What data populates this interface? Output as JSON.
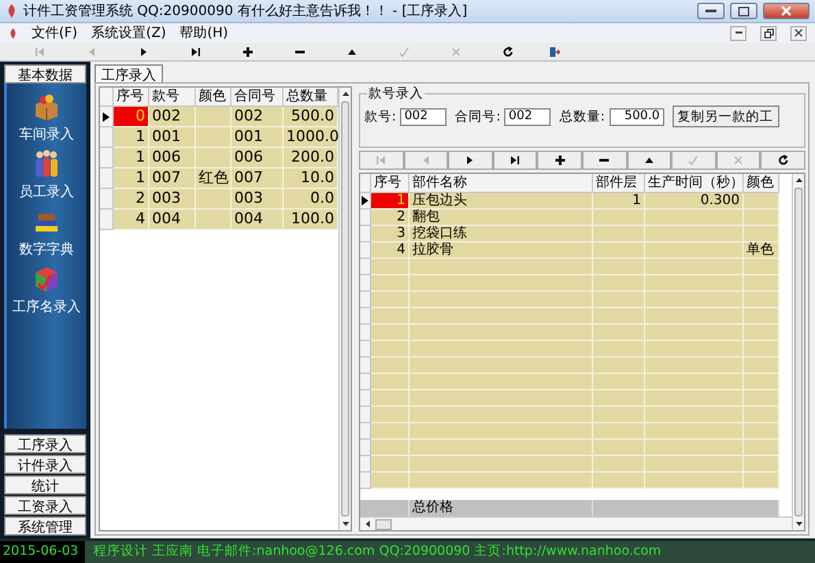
{
  "window": {
    "title": "计件工资管理系统  QQ:20900090    有什么好主意告诉我！！ - [工序录入]"
  },
  "menu": [
    "文件(F)",
    "系统设置(Z)",
    "帮助(H)"
  ],
  "toolbar": [
    {
      "kind": "first",
      "disabled": true
    },
    {
      "kind": "prior",
      "disabled": true
    },
    {
      "kind": "next",
      "disabled": false
    },
    {
      "kind": "last",
      "disabled": false
    },
    {
      "kind": "insert",
      "disabled": false
    },
    {
      "kind": "delete",
      "disabled": false
    },
    {
      "kind": "edit",
      "disabled": false
    },
    {
      "kind": "post",
      "disabled": true
    },
    {
      "kind": "cancel",
      "disabled": true
    },
    {
      "kind": "refresh",
      "disabled": false
    },
    {
      "kind": "exit",
      "disabled": false
    }
  ],
  "sidebar": {
    "header": "基本数据",
    "items": [
      {
        "kind": "box",
        "label": "车间录入"
      },
      {
        "kind": "people",
        "label": "员工录入"
      },
      {
        "kind": "books",
        "label": "数字字典"
      },
      {
        "kind": "cube",
        "label": "工序名录入"
      }
    ],
    "buttons": [
      "工序录入",
      "计件录入",
      "统计",
      "工资录入",
      "系统管理"
    ]
  },
  "tab": {
    "label": "工序录入",
    "selected": true
  },
  "style_grid": {
    "columns": [
      "序号",
      "款号",
      "颜色",
      "合同号",
      "总数量"
    ],
    "rows": [
      {
        "selected": true,
        "cells": [
          "0",
          "002",
          "",
          "002",
          "500.0"
        ]
      },
      {
        "selected": false,
        "cells": [
          "1",
          "001",
          "",
          "001",
          "1000.0"
        ]
      },
      {
        "selected": false,
        "cells": [
          "1",
          "006",
          "",
          "006",
          "200.0"
        ]
      },
      {
        "selected": false,
        "cells": [
          "1",
          "007",
          "红色",
          "007",
          "10.0"
        ]
      },
      {
        "selected": false,
        "cells": [
          "2",
          "003",
          "",
          "003",
          "0.0"
        ]
      },
      {
        "selected": false,
        "cells": [
          "4",
          "004",
          "",
          "004",
          "100.0"
        ]
      }
    ]
  },
  "entry": {
    "title": "款号录入",
    "fields": [
      {
        "label": "款号:",
        "value": "002"
      },
      {
        "label": "合同号:",
        "value": "002"
      },
      {
        "label": "总数量:",
        "value": "500.0"
      }
    ],
    "button": "复制另一款的工"
  },
  "nav": [
    {
      "kind": "first",
      "disabled": true
    },
    {
      "kind": "prior",
      "disabled": true
    },
    {
      "kind": "next",
      "disabled": false
    },
    {
      "kind": "last",
      "disabled": false
    },
    {
      "kind": "insert",
      "disabled": false
    },
    {
      "kind": "delete",
      "disabled": false
    },
    {
      "kind": "edit",
      "disabled": false
    },
    {
      "kind": "post",
      "disabled": true
    },
    {
      "kind": "cancel",
      "disabled": true
    },
    {
      "kind": "refresh",
      "disabled": false
    }
  ],
  "process_grid": {
    "columns": [
      "序号",
      "部件名称",
      "部件层",
      "生产时间（秒）",
      "颜色"
    ],
    "rows": [
      {
        "selected": true,
        "cells": [
          "1",
          "压包边头",
          "1",
          "0.300",
          ""
        ]
      },
      {
        "selected": false,
        "cells": [
          "2",
          "翻包",
          "",
          "",
          ""
        ]
      },
      {
        "selected": false,
        "cells": [
          "3",
          "挖袋口练",
          "",
          "",
          ""
        ]
      },
      {
        "selected": false,
        "cells": [
          "4",
          "拉胶骨",
          "",
          "",
          "单色"
        ]
      }
    ],
    "footer": "总价格"
  },
  "status_bar": {
    "date": "2015-06-03",
    "info": "程序设计 王应南 电子邮件:nanhoo@126.com  QQ:20900090 主页:http://www.nanhoo.com"
  }
}
